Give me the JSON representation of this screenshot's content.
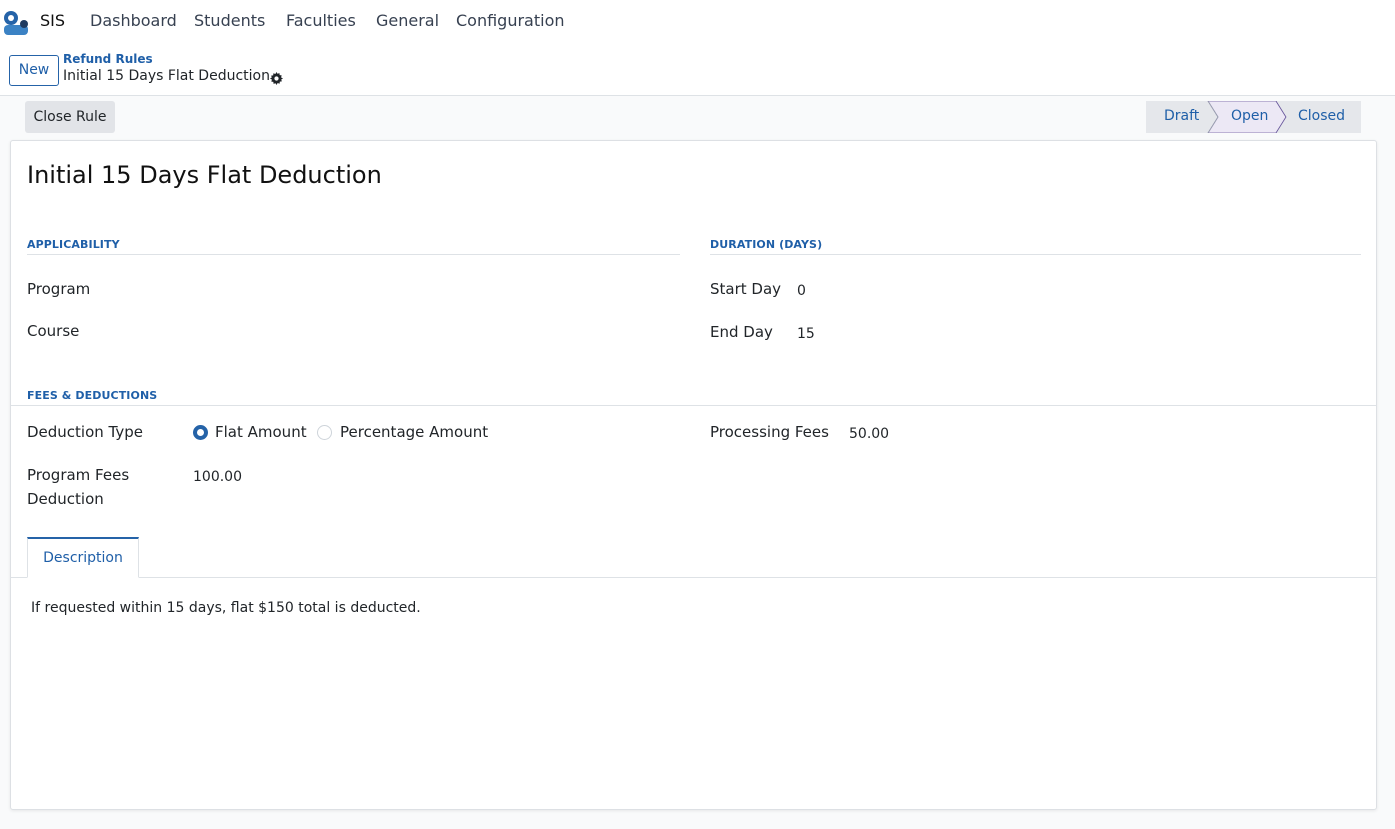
{
  "nav": {
    "app_name": "SIS",
    "items": [
      "Dashboard",
      "Students",
      "Faculties",
      "General",
      "Configuration"
    ]
  },
  "control": {
    "new_label": "New",
    "breadcrumb_parent": "Refund Rules",
    "breadcrumb_current": "Initial 15 Days Flat Deduction"
  },
  "actions": {
    "close_rule_label": "Close Rule"
  },
  "status": {
    "stages": [
      "Draft",
      "Open",
      "Closed"
    ],
    "active": "Open"
  },
  "form": {
    "title": "Initial 15 Days Flat Deduction",
    "applicability": {
      "heading": "APPLICABILITY",
      "program_label": "Program",
      "program_value": "",
      "course_label": "Course",
      "course_value": ""
    },
    "duration": {
      "heading": "DURATION (DAYS)",
      "start_label": "Start Day",
      "start_value": "0",
      "end_label": "End Day",
      "end_value": "15"
    },
    "fees": {
      "heading": "FEES & DEDUCTIONS",
      "deduction_type_label": "Deduction Type",
      "options": [
        "Flat Amount",
        "Percentage Amount"
      ],
      "selected": "Flat Amount",
      "program_fees_label_1": "Program Fees",
      "program_fees_label_2": "Deduction",
      "program_fees_value": "100.00",
      "processing_label": "Processing Fees",
      "processing_value": "50.00"
    },
    "tabs": [
      "Description"
    ],
    "description": "If requested within 15 days, flat $150 total is deducted."
  },
  "colors": {
    "accent": "#1f5fa8",
    "active_stage_bg": "#ece8f5",
    "stage_bg": "#e5e7eb"
  }
}
